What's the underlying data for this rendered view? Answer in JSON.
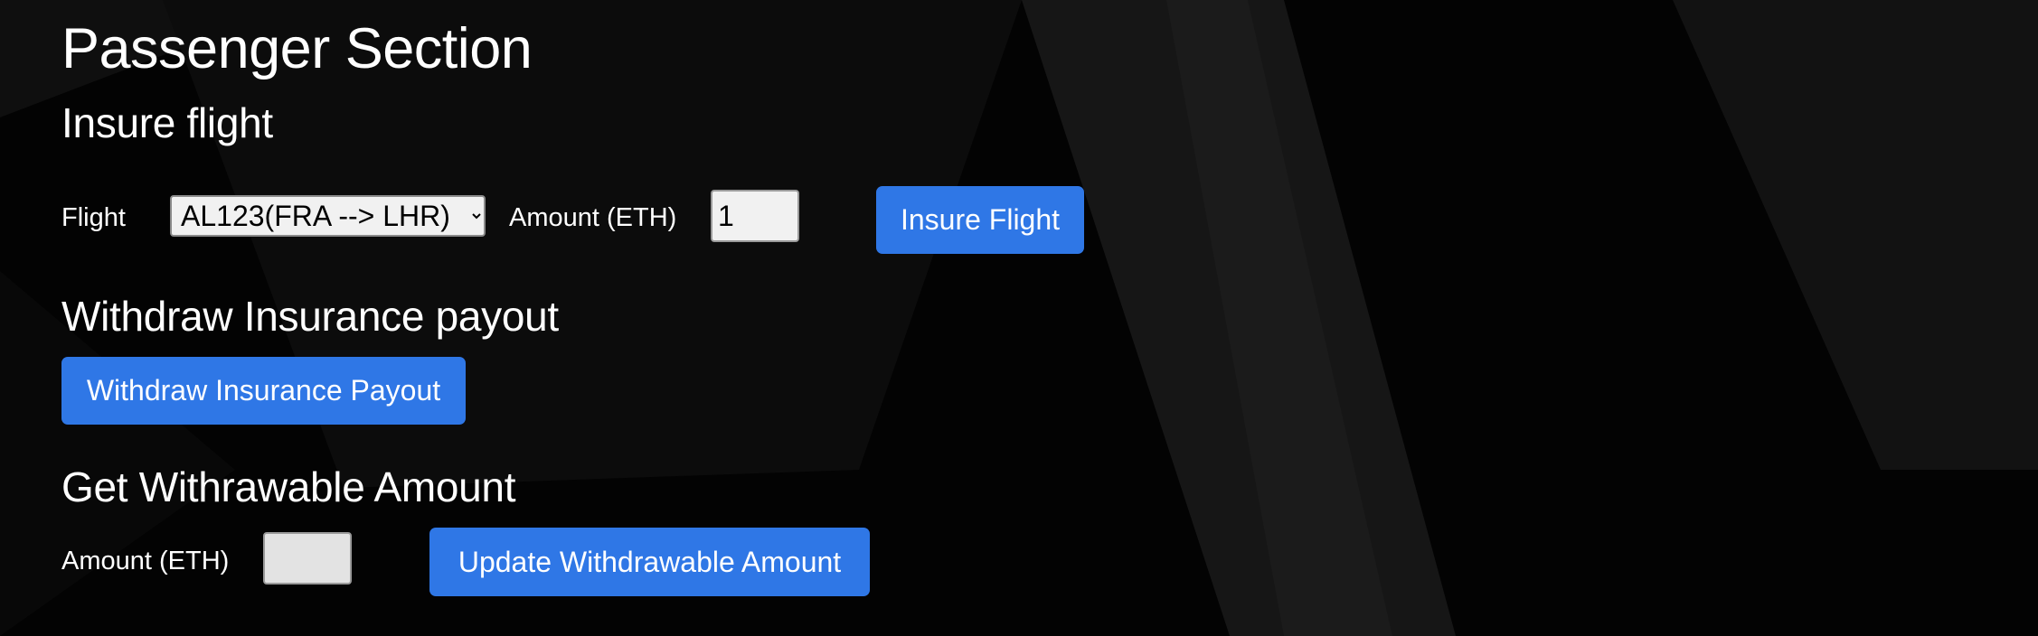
{
  "page": {
    "title": "Passenger Section",
    "background_color": "#030303",
    "accent_color": "#2f77e6"
  },
  "insure": {
    "heading": "Insure flight",
    "flight_label": "Flight",
    "flight_selected": "AL123(FRA --> LHR)",
    "amount_label": "Amount (ETH)",
    "amount_value": "1",
    "button_label": "Insure Flight"
  },
  "withdraw": {
    "heading": "Withdraw Insurance payout",
    "button_label": "Withdraw Insurance Payout"
  },
  "withdrawable": {
    "heading": "Get Withrawable Amount",
    "amount_label": "Amount (ETH)",
    "amount_value": "",
    "button_label": "Update Withdrawable Amount"
  }
}
